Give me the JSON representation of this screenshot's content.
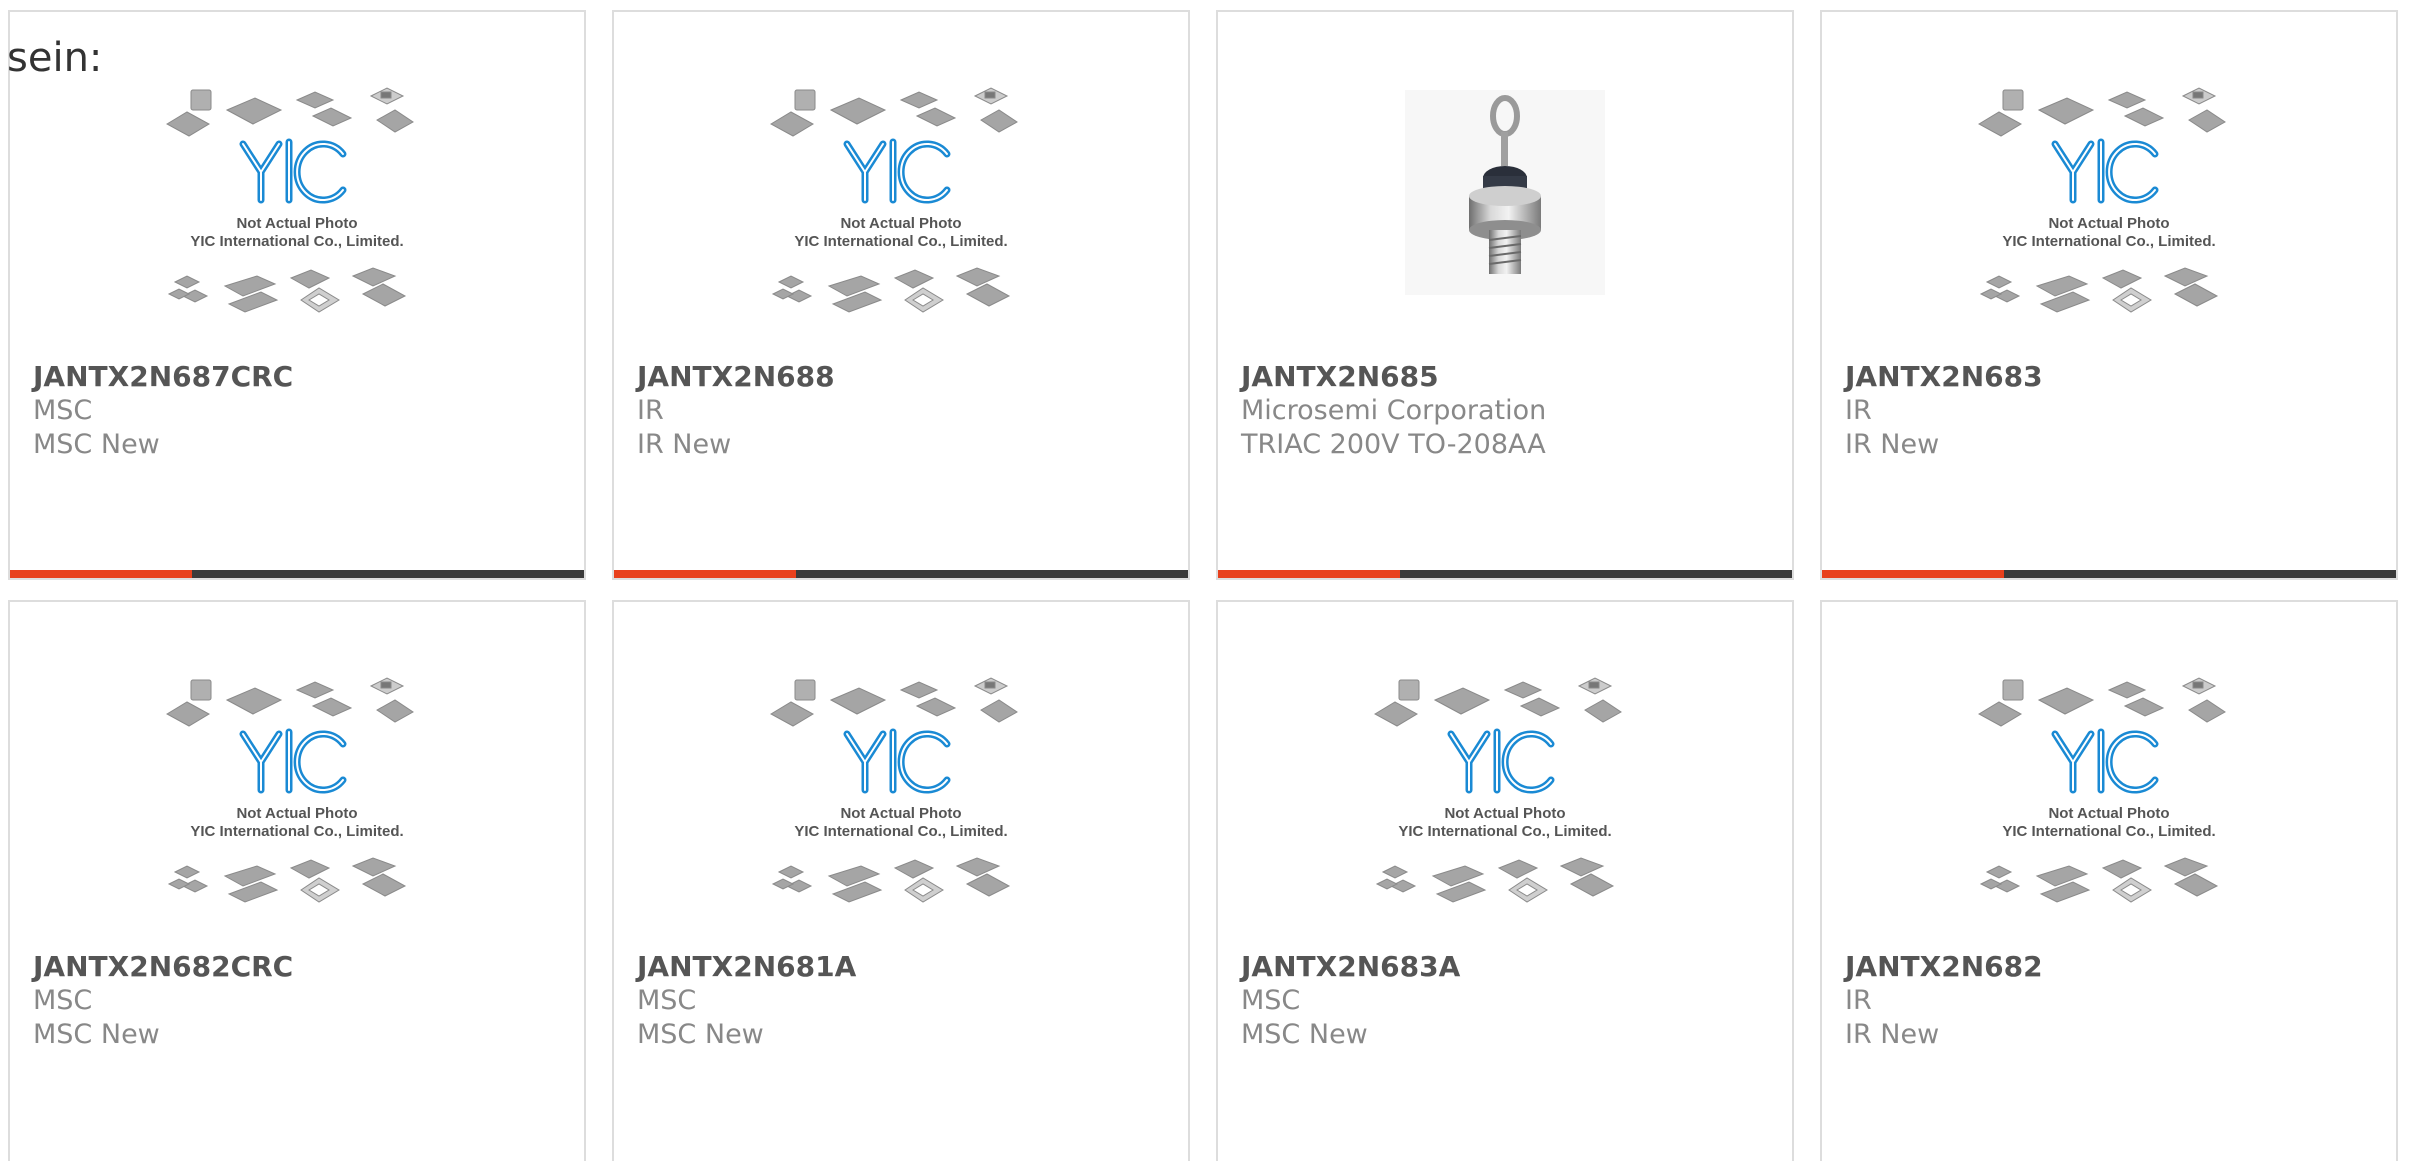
{
  "lead_text": "sein:",
  "placeholder": {
    "line1": "Not Actual Photo",
    "line2": "YIC International Co., Limited."
  },
  "colors": {
    "accent": "#e8401c",
    "bar": "#3a3a3a",
    "logo_blue": "#1a8ad4",
    "border": "#dddddd"
  },
  "products": [
    {
      "part_number": "JANTX2N687CRC",
      "manufacturer": "MSC",
      "description": "MSC New",
      "image": "placeholder-photo"
    },
    {
      "part_number": "JANTX2N688",
      "manufacturer": "IR",
      "description": "IR New",
      "image": "placeholder-photo"
    },
    {
      "part_number": "JANTX2N685",
      "manufacturer": "Microsemi Corporation",
      "description": "TRIAC 200V TO-208AA",
      "image": "stud-mount-triac-photo"
    },
    {
      "part_number": "JANTX2N683",
      "manufacturer": "IR",
      "description": "IR New",
      "image": "placeholder-photo"
    },
    {
      "part_number": "JANTX2N682CRC",
      "manufacturer": "MSC",
      "description": "MSC New",
      "image": "placeholder-photo"
    },
    {
      "part_number": "JANTX2N681A",
      "manufacturer": "MSC",
      "description": "MSC New",
      "image": "placeholder-photo"
    },
    {
      "part_number": "JANTX2N683A",
      "manufacturer": "MSC",
      "description": "MSC New",
      "image": "placeholder-photo"
    },
    {
      "part_number": "JANTX2N682",
      "manufacturer": "IR",
      "description": "IR New",
      "image": "placeholder-photo"
    }
  ]
}
